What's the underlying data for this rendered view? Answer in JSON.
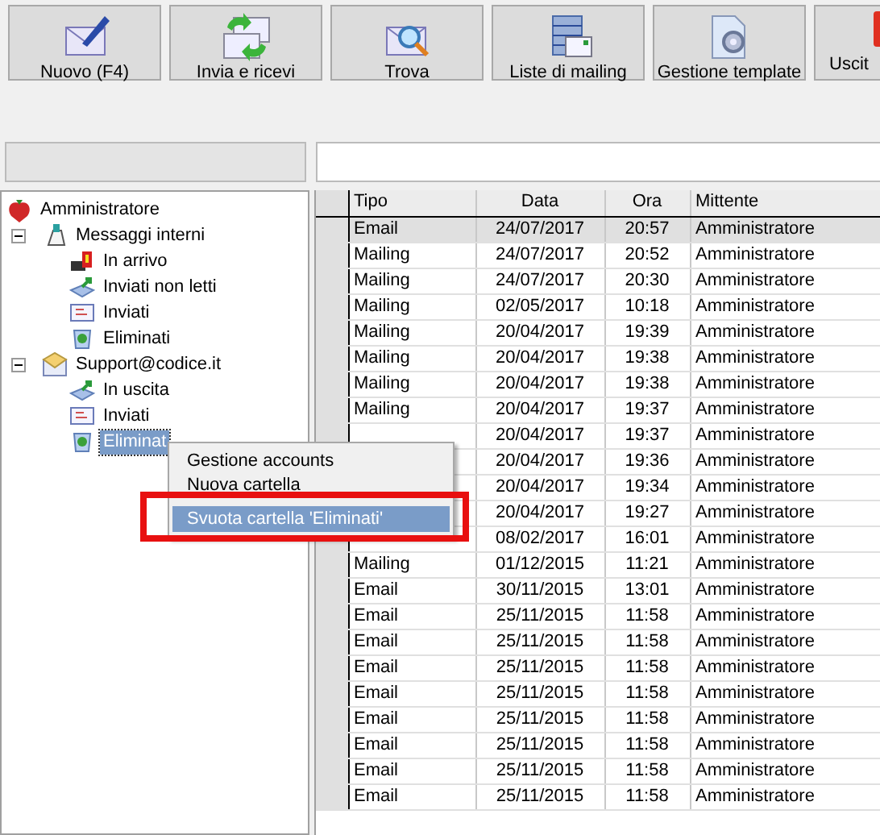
{
  "toolbar": [
    {
      "label": "Nuovo (F4)"
    },
    {
      "label": "Invia e ricevi"
    },
    {
      "label": "Trova"
    },
    {
      "label": "Liste di mailing"
    },
    {
      "label": "Gestione template"
    },
    {
      "label": "Uscit"
    }
  ],
  "tree": [
    {
      "label": "Amministratore",
      "selected": false,
      "children": [
        {
          "label": "Messaggi interni",
          "selected": false,
          "expanded": true,
          "children": [
            {
              "label": "In arrivo",
              "selected": false
            },
            {
              "label": "Inviati non letti",
              "selected": false
            },
            {
              "label": "Inviati",
              "selected": false
            },
            {
              "label": "Eliminati",
              "selected": false
            }
          ]
        },
        {
          "label": "Support@codice.it",
          "selected": false,
          "expanded": true,
          "children": [
            {
              "label": "In uscita",
              "selected": false
            },
            {
              "label": "Inviati",
              "selected": false
            },
            {
              "label": "Eliminat",
              "selected": true
            }
          ]
        }
      ]
    }
  ],
  "table": {
    "columns": [
      "Tipo",
      "Data",
      "Ora",
      "Mittente"
    ],
    "rows": [
      {
        "selected": true,
        "tipo": "Email",
        "data": "24/07/2017",
        "ora": "20:57",
        "mittente": "Amministratore"
      },
      {
        "selected": false,
        "tipo": "Mailing",
        "data": "24/07/2017",
        "ora": "20:52",
        "mittente": "Amministratore"
      },
      {
        "selected": false,
        "tipo": "Mailing",
        "data": "24/07/2017",
        "ora": "20:30",
        "mittente": "Amministratore"
      },
      {
        "selected": false,
        "tipo": "Mailing",
        "data": "02/05/2017",
        "ora": "10:18",
        "mittente": "Amministratore"
      },
      {
        "selected": false,
        "tipo": "Mailing",
        "data": "20/04/2017",
        "ora": "19:39",
        "mittente": "Amministratore"
      },
      {
        "selected": false,
        "tipo": "Mailing",
        "data": "20/04/2017",
        "ora": "19:38",
        "mittente": "Amministratore"
      },
      {
        "selected": false,
        "tipo": "Mailing",
        "data": "20/04/2017",
        "ora": "19:38",
        "mittente": "Amministratore"
      },
      {
        "selected": false,
        "tipo": "Mailing",
        "data": "20/04/2017",
        "ora": "19:37",
        "mittente": "Amministratore"
      },
      {
        "selected": false,
        "data": "20/04/2017",
        "ora": "19:37",
        "mittente": "Amministratore"
      },
      {
        "selected": false,
        "data": "20/04/2017",
        "ora": "19:36",
        "mittente": "Amministratore"
      },
      {
        "selected": false,
        "data": "20/04/2017",
        "ora": "19:34",
        "mittente": "Amministratore"
      },
      {
        "selected": false,
        "data": "20/04/2017",
        "ora": "19:27",
        "mittente": "Amministratore"
      },
      {
        "selected": false,
        "data": "08/02/2017",
        "ora": "16:01",
        "mittente": "Amministratore"
      },
      {
        "selected": false,
        "tipo": "Mailing",
        "data": "01/12/2015",
        "ora": "11:21",
        "mittente": "Amministratore"
      },
      {
        "selected": false,
        "tipo": "Email",
        "data": "30/11/2015",
        "ora": "13:01",
        "mittente": "Amministratore"
      },
      {
        "selected": false,
        "tipo": "Email",
        "data": "25/11/2015",
        "ora": "11:58",
        "mittente": "Amministratore"
      },
      {
        "selected": false,
        "tipo": "Email",
        "data": "25/11/2015",
        "ora": "11:58",
        "mittente": "Amministratore"
      },
      {
        "selected": false,
        "tipo": "Email",
        "data": "25/11/2015",
        "ora": "11:58",
        "mittente": "Amministratore"
      },
      {
        "selected": false,
        "tipo": "Email",
        "data": "25/11/2015",
        "ora": "11:58",
        "mittente": "Amministratore"
      },
      {
        "selected": false,
        "tipo": "Email",
        "data": "25/11/2015",
        "ora": "11:58",
        "mittente": "Amministratore"
      },
      {
        "selected": false,
        "tipo": "Email",
        "data": "25/11/2015",
        "ora": "11:58",
        "mittente": "Amministratore"
      },
      {
        "selected": false,
        "tipo": "Email",
        "data": "25/11/2015",
        "ora": "11:58",
        "mittente": "Amministratore"
      },
      {
        "selected": false,
        "tipo": "Email",
        "data": "25/11/2015",
        "ora": "11:58",
        "mittente": "Amministratore"
      }
    ]
  },
  "context_menu": {
    "items": [
      {
        "label": "Gestione accounts",
        "selected": false
      },
      {
        "label": "Nuova cartella",
        "selected": false
      },
      {
        "label": "Svuota cartella 'Eliminati'",
        "selected": true
      }
    ]
  }
}
